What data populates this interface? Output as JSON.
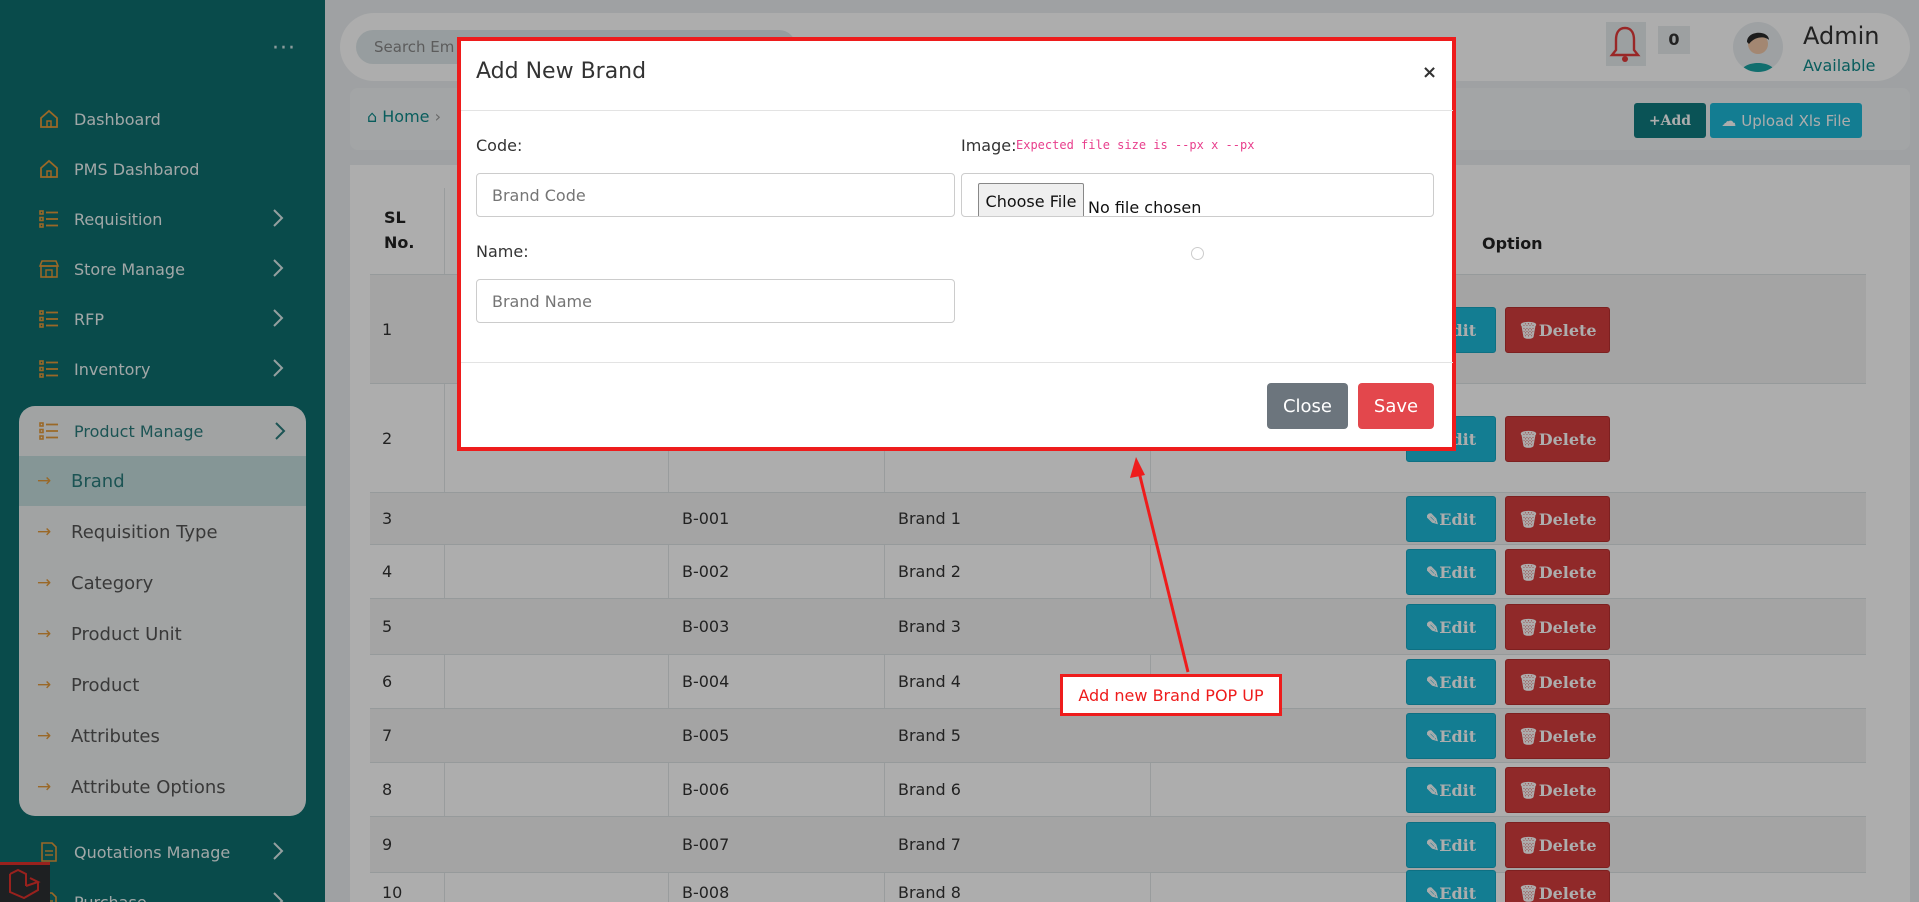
{
  "sidebar": {
    "menu_icon": "ellipsis-icon",
    "items": [
      {
        "label": "Dashboard",
        "icon": "home-icon"
      },
      {
        "label": "PMS Dashbarod",
        "icon": "home-icon"
      },
      {
        "label": "Requisition",
        "icon": "list-icon"
      },
      {
        "label": "Store Manage",
        "icon": "store-icon"
      },
      {
        "label": "RFP",
        "icon": "list-icon"
      },
      {
        "label": "Inventory",
        "icon": "list-icon"
      }
    ],
    "product_manage": {
      "label": "Product Manage",
      "children": [
        "Brand",
        "Requisition Type",
        "Category",
        "Product Unit",
        "Product",
        "Attributes",
        "Attribute Options"
      ],
      "active": "Brand"
    },
    "bottom_items": [
      {
        "label": "Quotations Manage"
      },
      {
        "label": "Purchase"
      }
    ]
  },
  "header": {
    "search_placeholder": "Search Em",
    "notification_count": "0",
    "user_name": "Admin",
    "user_status": "Available"
  },
  "breadcrumb": {
    "home": "Home"
  },
  "actions": {
    "add": "Add",
    "upload": "Upload Xls File"
  },
  "table": {
    "headers": {
      "sl": "SL",
      "sl2": "No.",
      "option": "Option"
    },
    "rows": [
      {
        "sl": "1",
        "code": "",
        "name": ""
      },
      {
        "sl": "2",
        "code": "",
        "name": ""
      },
      {
        "sl": "3",
        "code": "B-001",
        "name": "Brand 1"
      },
      {
        "sl": "4",
        "code": "B-002",
        "name": "Brand 2"
      },
      {
        "sl": "5",
        "code": "B-003",
        "name": "Brand 3"
      },
      {
        "sl": "6",
        "code": "B-004",
        "name": "Brand 4"
      },
      {
        "sl": "7",
        "code": "B-005",
        "name": "Brand 5"
      },
      {
        "sl": "8",
        "code": "B-006",
        "name": "Brand 6"
      },
      {
        "sl": "9",
        "code": "B-007",
        "name": "Brand 7"
      },
      {
        "sl": "10",
        "code": "B-008",
        "name": "Brand 8"
      }
    ],
    "edit_label": "Edit",
    "delete_label": "Delete"
  },
  "modal": {
    "title": "Add New Brand",
    "close_x": "×",
    "code_label": "Code:",
    "code_placeholder": "Brand Code",
    "image_label": "Image:",
    "image_hint": "Expected file size is --px x --px",
    "choose_file": "Choose File",
    "no_file": "No file chosen",
    "name_label": "Name:",
    "name_placeholder": "Brand Name",
    "close_button": "Close",
    "save_button": "Save"
  },
  "annotation": {
    "text": "Add new Brand POP UP",
    "color": "#ee1c1c"
  },
  "colors": {
    "sidebar": "#0e6f6f",
    "accent": "#1cb9d8",
    "danger": "#d43d3d",
    "orange": "#e39a3a"
  }
}
